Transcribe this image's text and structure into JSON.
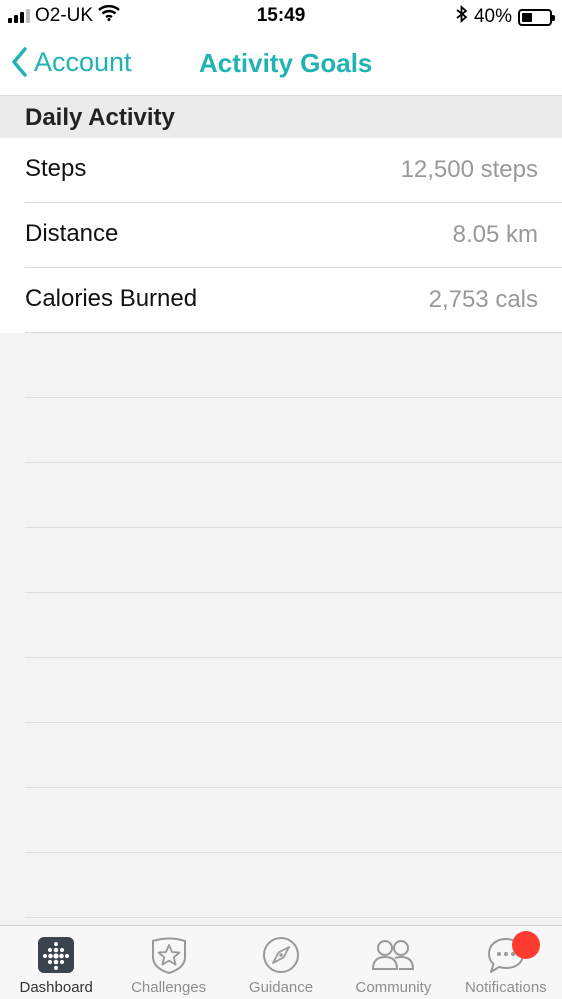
{
  "status_bar": {
    "carrier": "O2-UK",
    "time": "15:49",
    "battery": "40%",
    "battery_level": 0.4,
    "icons": [
      "signal-icon",
      "wifi-icon",
      "bluetooth-icon",
      "battery-icon"
    ]
  },
  "nav": {
    "back_label": "Account",
    "title": "Activity Goals"
  },
  "section": {
    "title": "Daily Activity"
  },
  "rows": [
    {
      "label": "Steps",
      "value": "12,500 steps"
    },
    {
      "label": "Distance",
      "value": "8.05 km"
    },
    {
      "label": "Calories Burned",
      "value": "2,753 cals"
    }
  ],
  "tabs": [
    {
      "label": "Dashboard",
      "icon": "dashboard-icon"
    },
    {
      "label": "Challenges",
      "icon": "challenges-star-icon"
    },
    {
      "label": "Guidance",
      "icon": "compass-icon"
    },
    {
      "label": "Community",
      "icon": "community-people-icon"
    },
    {
      "label": "Notifications",
      "icon": "chat-bubble-icon"
    }
  ],
  "colors": {
    "accent": "#1fb3b3",
    "badge": "#ff3b30"
  }
}
